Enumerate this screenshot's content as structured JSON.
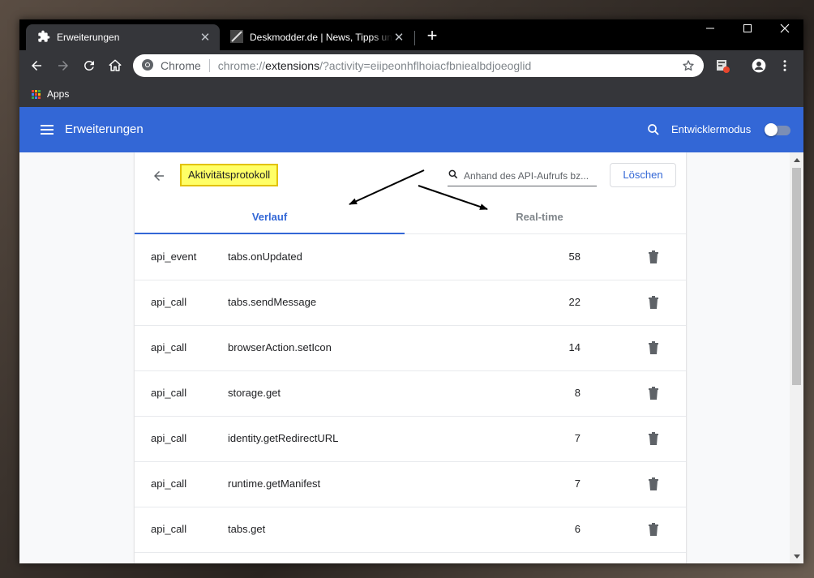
{
  "browser": {
    "tabs": [
      {
        "label": "Erweiterungen",
        "icon": "puzzle-icon",
        "active": true
      },
      {
        "label": "Deskmodder.de | News, Tipps und",
        "icon": "deskmodder-favicon",
        "active": false
      }
    ],
    "new_tab": "+",
    "omnibox": {
      "chip": "Chrome",
      "url_scheme": "chrome://",
      "url_host": "extensions",
      "url_rest": "/?activity=eiipeonhflhoiacfbniealbdjoeoglid"
    },
    "bookmarks": [
      {
        "label": "Apps"
      }
    ]
  },
  "extensions_header": {
    "title": "Erweiterungen",
    "dev_mode_label": "Entwicklermodus",
    "dev_mode_on": false
  },
  "activity": {
    "title": "Aktivitätsprotokoll",
    "search_placeholder": "Anhand des API-Aufrufs bz...",
    "clear_label": "Löschen",
    "tabs": [
      {
        "label": "Verlauf",
        "selected": true
      },
      {
        "label": "Real-time",
        "selected": false
      }
    ],
    "rows": [
      {
        "type": "api_event",
        "name": "tabs.onUpdated",
        "count": "58"
      },
      {
        "type": "api_call",
        "name": "tabs.sendMessage",
        "count": "22"
      },
      {
        "type": "api_call",
        "name": "browserAction.setIcon",
        "count": "14"
      },
      {
        "type": "api_call",
        "name": "storage.get",
        "count": "8"
      },
      {
        "type": "api_call",
        "name": "identity.getRedirectURL",
        "count": "7"
      },
      {
        "type": "api_call",
        "name": "runtime.getManifest",
        "count": "7"
      },
      {
        "type": "api_call",
        "name": "tabs.get",
        "count": "6"
      }
    ]
  },
  "colors": {
    "header_blue": "#3367d6",
    "highlight_yellow": "#ffff66",
    "tab_dark": "#35363a"
  }
}
